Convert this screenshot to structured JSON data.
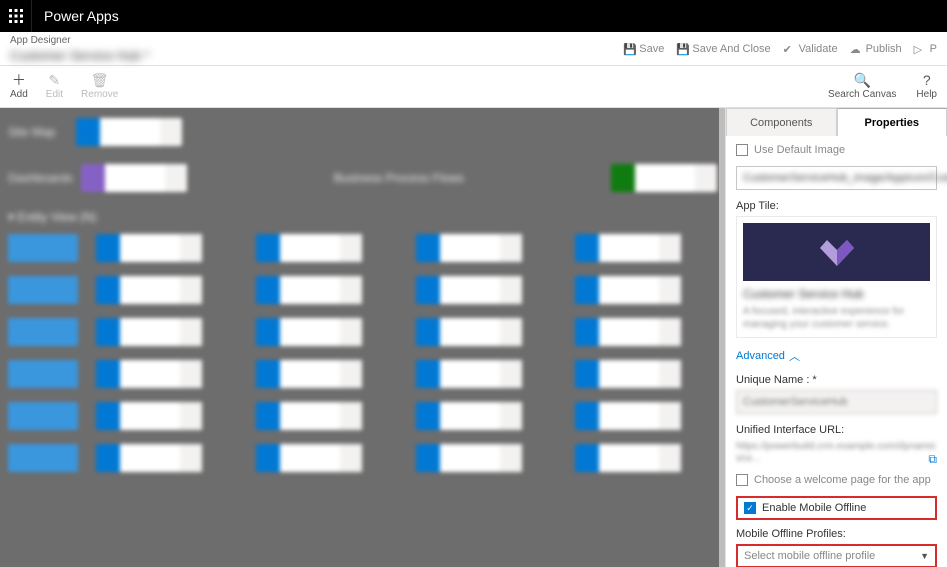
{
  "topbar": {
    "brand": "Power Apps"
  },
  "subbar": {
    "label": "App Designer",
    "title": "Customer Service Hub *",
    "actions": {
      "save": "Save",
      "save_close": "Save And Close",
      "validate": "Validate",
      "publish": "Publish",
      "play": "P"
    }
  },
  "toolbar": {
    "add": "Add",
    "edit": "Edit",
    "remove": "Remove",
    "search": "Search Canvas",
    "help": "Help"
  },
  "panel": {
    "tabs": {
      "components": "Components",
      "properties": "Properties"
    },
    "use_default_image_label": "Use Default Image",
    "image_dropdown_value": "CustomerServiceHub_image/AppIcon/Customer...",
    "app_tile_label": "App Tile:",
    "tile_title": "Customer Service Hub",
    "tile_desc": "A focused, interactive experience for managing your customer service.",
    "advanced_label": "Advanced",
    "unique_name_label": "Unique Name : *",
    "unique_name_value": "CustomerServiceHub",
    "url_label": "Unified Interface URL:",
    "url_value": "https://powerbuild.crm.example.com/dynamics/ui...",
    "welcome_label": "Choose a welcome page for the app",
    "enable_offline_label": "Enable Mobile Offline",
    "profiles_label": "Mobile Offline Profiles:",
    "profiles_placeholder": "Select mobile offline profile"
  }
}
